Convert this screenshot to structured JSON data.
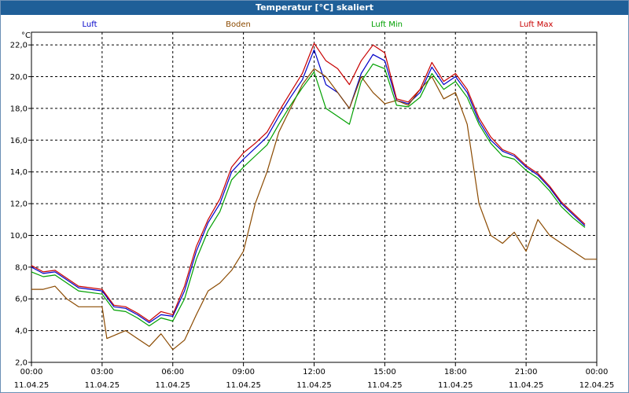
{
  "window": {
    "title": "Temperatur [°C] skaliert"
  },
  "chart_data": {
    "type": "line",
    "title": "Temperatur [°C] skaliert",
    "ylabel": "°C",
    "ylim": [
      2.0,
      22.8
    ],
    "xlim": [
      "11.04.25 00:00",
      "12.04.25 00:00"
    ],
    "grid": true,
    "legend": "top",
    "y_ticks": [
      "2,0",
      "4,0",
      "6,0",
      "8,0",
      "10,0",
      "12,0",
      "14,0",
      "16,0",
      "18,0",
      "20,0",
      "22,0"
    ],
    "x_ticks": [
      {
        "time": "00:00",
        "date": "11.04.25"
      },
      {
        "time": "03:00",
        "date": "11.04.25"
      },
      {
        "time": "06:00",
        "date": "11.04.25"
      },
      {
        "time": "09:00",
        "date": "11.04.25"
      },
      {
        "time": "12:00",
        "date": "11.04.25"
      },
      {
        "time": "15:00",
        "date": "11.04.25"
      },
      {
        "time": "18:00",
        "date": "11.04.25"
      },
      {
        "time": "21:00",
        "date": "11.04.25"
      },
      {
        "time": "00:00",
        "date": "12.04.25"
      }
    ],
    "series": [
      {
        "name": "Luft",
        "color": "#0000c8",
        "points": [
          [
            0,
            8.0
          ],
          [
            0.5,
            7.6
          ],
          [
            1,
            7.7
          ],
          [
            2,
            6.7
          ],
          [
            3,
            6.5
          ],
          [
            3.5,
            5.5
          ],
          [
            4,
            5.4
          ],
          [
            4.5,
            5.0
          ],
          [
            5,
            4.5
          ],
          [
            5.5,
            5.0
          ],
          [
            6,
            4.9
          ],
          [
            6.5,
            6.5
          ],
          [
            7,
            9.0
          ],
          [
            7.5,
            10.8
          ],
          [
            8,
            12.0
          ],
          [
            8.5,
            14.0
          ],
          [
            9,
            14.8
          ],
          [
            9.5,
            15.5
          ],
          [
            10,
            16.2
          ],
          [
            10.5,
            17.5
          ],
          [
            11,
            18.7
          ],
          [
            11.5,
            19.8
          ],
          [
            12,
            21.7
          ],
          [
            12.5,
            19.5
          ],
          [
            13,
            19.0
          ],
          [
            13.5,
            18.0
          ],
          [
            14,
            20.2
          ],
          [
            14.5,
            21.4
          ],
          [
            15,
            21.0
          ],
          [
            15.5,
            18.5
          ],
          [
            16,
            18.3
          ],
          [
            16.5,
            19.0
          ],
          [
            17,
            20.6
          ],
          [
            17.5,
            19.5
          ],
          [
            18,
            20.0
          ],
          [
            18.5,
            19.0
          ],
          [
            19,
            17.2
          ],
          [
            19.5,
            16.0
          ],
          [
            20,
            15.3
          ],
          [
            20.5,
            15.0
          ],
          [
            21,
            14.3
          ],
          [
            21.5,
            13.8
          ],
          [
            22,
            13.0
          ],
          [
            22.5,
            12.0
          ],
          [
            23,
            11.3
          ],
          [
            23.5,
            10.6
          ]
        ]
      },
      {
        "name": "Boden",
        "color": "#8b4a00",
        "points": [
          [
            0,
            6.6
          ],
          [
            0.5,
            6.6
          ],
          [
            1,
            6.8
          ],
          [
            1.5,
            6.0
          ],
          [
            2,
            5.5
          ],
          [
            3,
            5.5
          ],
          [
            3.2,
            3.5
          ],
          [
            4,
            4.0
          ],
          [
            4.5,
            3.5
          ],
          [
            5,
            3.0
          ],
          [
            5.5,
            3.8
          ],
          [
            6,
            2.8
          ],
          [
            6.5,
            3.4
          ],
          [
            7,
            5.0
          ],
          [
            7.5,
            6.5
          ],
          [
            8,
            7.0
          ],
          [
            8.5,
            7.8
          ],
          [
            9,
            9.0
          ],
          [
            9.5,
            12.0
          ],
          [
            10,
            14.0
          ],
          [
            10.5,
            16.5
          ],
          [
            11,
            18.0
          ],
          [
            11.5,
            19.5
          ],
          [
            12,
            20.5
          ],
          [
            12.5,
            20.0
          ],
          [
            13,
            19.0
          ],
          [
            13.5,
            18.0
          ],
          [
            14,
            20.0
          ],
          [
            14.5,
            19.0
          ],
          [
            15,
            18.3
          ],
          [
            15.5,
            18.5
          ],
          [
            16,
            18.2
          ],
          [
            16.5,
            19.2
          ],
          [
            17,
            20.0
          ],
          [
            17.5,
            18.6
          ],
          [
            18,
            19.0
          ],
          [
            18.5,
            17.0
          ],
          [
            19,
            12.0
          ],
          [
            19.5,
            10.0
          ],
          [
            20,
            9.5
          ],
          [
            20.5,
            10.2
          ],
          [
            21,
            9.0
          ],
          [
            21.5,
            11.0
          ],
          [
            22,
            10.0
          ],
          [
            22.5,
            9.5
          ],
          [
            23,
            9.0
          ],
          [
            23.5,
            8.5
          ],
          [
            24,
            8.5
          ]
        ]
      },
      {
        "name": "Luft Min",
        "color": "#00a000",
        "points": [
          [
            0,
            7.7
          ],
          [
            0.5,
            7.4
          ],
          [
            1,
            7.5
          ],
          [
            2,
            6.5
          ],
          [
            3,
            6.3
          ],
          [
            3.5,
            5.3
          ],
          [
            4,
            5.2
          ],
          [
            4.5,
            4.8
          ],
          [
            5,
            4.3
          ],
          [
            5.5,
            4.8
          ],
          [
            6,
            4.6
          ],
          [
            6.5,
            6.0
          ],
          [
            7,
            8.5
          ],
          [
            7.5,
            10.3
          ],
          [
            8,
            11.5
          ],
          [
            8.5,
            13.5
          ],
          [
            9,
            14.3
          ],
          [
            9.5,
            15.0
          ],
          [
            10,
            15.7
          ],
          [
            10.5,
            17.0
          ],
          [
            11,
            18.2
          ],
          [
            11.5,
            19.3
          ],
          [
            12,
            20.3
          ],
          [
            12.5,
            18.0
          ],
          [
            13,
            17.5
          ],
          [
            13.5,
            17.0
          ],
          [
            14,
            19.7
          ],
          [
            14.5,
            20.8
          ],
          [
            15,
            20.5
          ],
          [
            15.5,
            18.2
          ],
          [
            16,
            18.1
          ],
          [
            16.5,
            18.7
          ],
          [
            17,
            20.2
          ],
          [
            17.5,
            19.2
          ],
          [
            18,
            19.7
          ],
          [
            18.5,
            18.7
          ],
          [
            19,
            17.0
          ],
          [
            19.5,
            15.8
          ],
          [
            20,
            15.0
          ],
          [
            20.5,
            14.8
          ],
          [
            21,
            14.1
          ],
          [
            21.5,
            13.6
          ],
          [
            22,
            12.8
          ],
          [
            22.5,
            11.8
          ],
          [
            23,
            11.1
          ],
          [
            23.5,
            10.5
          ]
        ]
      },
      {
        "name": "Luft Max",
        "color": "#c80000",
        "points": [
          [
            0,
            8.1
          ],
          [
            0.5,
            7.7
          ],
          [
            1,
            7.8
          ],
          [
            2,
            6.8
          ],
          [
            3,
            6.6
          ],
          [
            3.5,
            5.6
          ],
          [
            4,
            5.5
          ],
          [
            4.5,
            5.1
          ],
          [
            5,
            4.6
          ],
          [
            5.5,
            5.2
          ],
          [
            6,
            5.0
          ],
          [
            6.5,
            6.8
          ],
          [
            7,
            9.3
          ],
          [
            7.5,
            11.0
          ],
          [
            8,
            12.3
          ],
          [
            8.5,
            14.3
          ],
          [
            9,
            15.2
          ],
          [
            9.5,
            15.8
          ],
          [
            10,
            16.5
          ],
          [
            10.5,
            17.8
          ],
          [
            11,
            19.0
          ],
          [
            11.5,
            20.2
          ],
          [
            12,
            22.1
          ],
          [
            12.5,
            21.0
          ],
          [
            13,
            20.5
          ],
          [
            13.5,
            19.5
          ],
          [
            14,
            21.0
          ],
          [
            14.5,
            22.0
          ],
          [
            15,
            21.5
          ],
          [
            15.5,
            18.6
          ],
          [
            16,
            18.4
          ],
          [
            16.5,
            19.2
          ],
          [
            17,
            20.9
          ],
          [
            17.5,
            19.7
          ],
          [
            18,
            20.2
          ],
          [
            18.5,
            19.2
          ],
          [
            19,
            17.4
          ],
          [
            19.5,
            16.2
          ],
          [
            20,
            15.4
          ],
          [
            20.5,
            15.1
          ],
          [
            21,
            14.4
          ],
          [
            21.5,
            13.9
          ],
          [
            22,
            13.1
          ],
          [
            22.5,
            12.1
          ],
          [
            23,
            11.4
          ],
          [
            23.5,
            10.7
          ]
        ]
      }
    ]
  }
}
